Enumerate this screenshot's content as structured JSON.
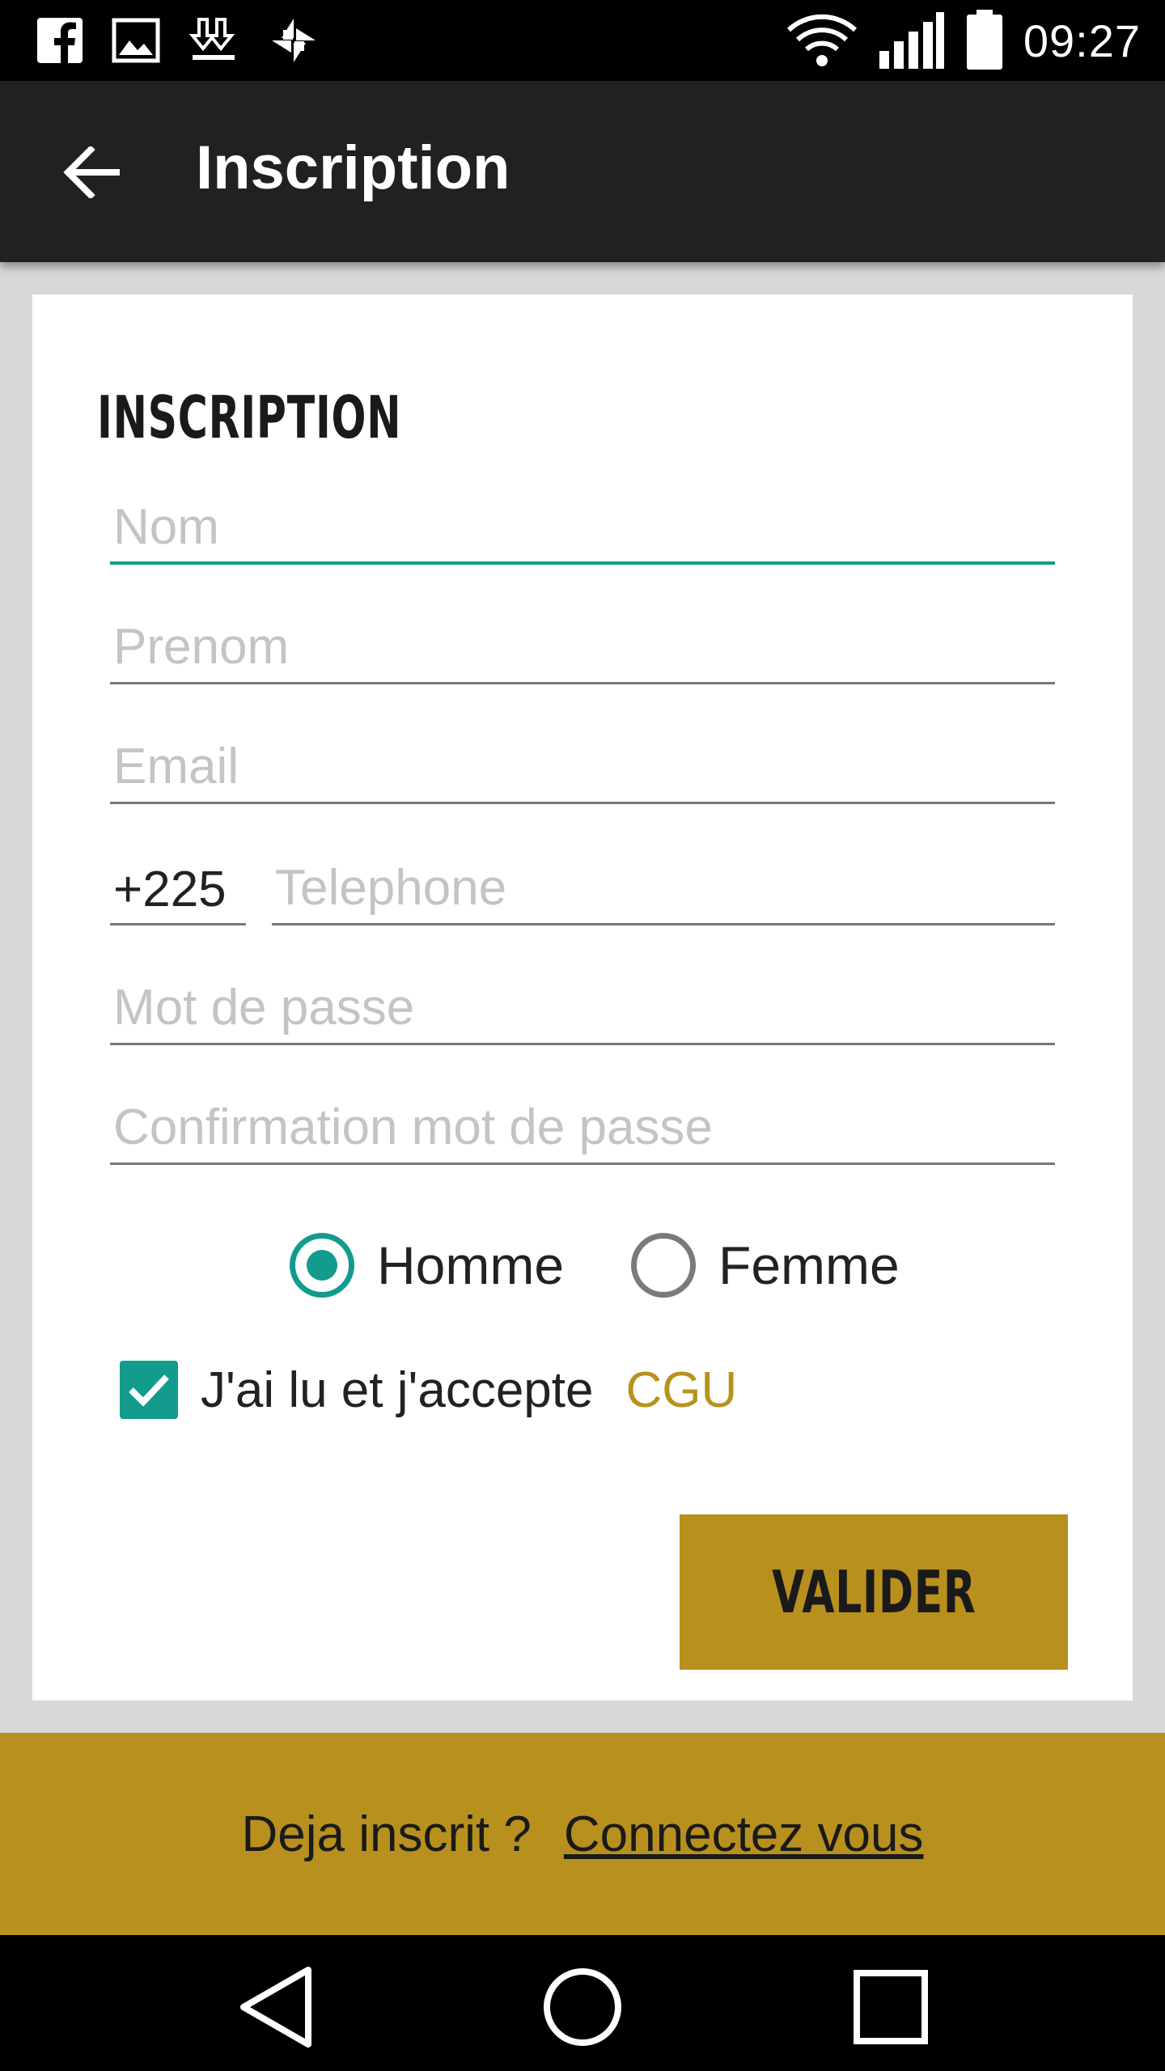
{
  "status_bar": {
    "time": "09:27",
    "left_icons": [
      "facebook-icon",
      "gallery-icon",
      "download-icon",
      "pinwheel-icon"
    ],
    "right_icons": [
      "wifi-icon",
      "signal-icon",
      "battery-icon"
    ]
  },
  "app_bar": {
    "title": "Inscription",
    "back_icon": "arrow-back-icon"
  },
  "form": {
    "heading": "INSCRIPTION",
    "fields": {
      "nom": {
        "placeholder": "Nom",
        "value": ""
      },
      "prenom": {
        "placeholder": "Prenom",
        "value": ""
      },
      "email": {
        "placeholder": "Email",
        "value": ""
      },
      "country_code": "+225",
      "telephone": {
        "placeholder": "Telephone",
        "value": ""
      },
      "password": {
        "placeholder": "Mot de passe",
        "value": ""
      },
      "password_confirm": {
        "placeholder": "Confirmation mot de passe",
        "value": ""
      }
    },
    "gender": {
      "options": [
        "Homme",
        "Femme"
      ],
      "selected": "Homme"
    },
    "terms": {
      "label": "J'ai lu et j'accepte",
      "link": "CGU",
      "checked": true
    },
    "submit_label": "VALIDER"
  },
  "banner": {
    "text": "Deja inscrit ?",
    "link": "Connectez vous"
  },
  "colors": {
    "accent": "#139b8e",
    "gold": "#b8901d",
    "app_bar": "#212121"
  },
  "nav_bar": {
    "icons": [
      "back-triangle-icon",
      "home-circle-icon",
      "recents-square-icon"
    ]
  }
}
